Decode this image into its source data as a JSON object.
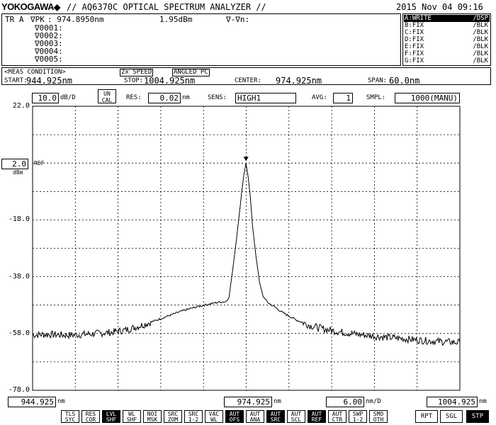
{
  "header": {
    "brand": "YOKOGAWA",
    "title": "// AQ6370C OPTICAL SPECTRUM ANALYZER //",
    "datetime": "2015 Nov 04 09:16"
  },
  "marker_panel": {
    "trace_label": "TR A",
    "peak_label": "∇PK",
    "peak_wavelength": ": 974.8950nm",
    "peak_level": "1.95dBm",
    "delta_label": "∇-∇n:",
    "markers": [
      "∇0001:",
      "∇0002:",
      "∇0003:",
      "∇0004:",
      "∇0005:"
    ]
  },
  "trace_list": [
    {
      "name": "A:WRITE",
      "mode": "/DSP",
      "active": true
    },
    {
      "name": "B:FIX",
      "mode": "/BLK",
      "active": false
    },
    {
      "name": "C:FIX",
      "mode": "/BLK",
      "active": false
    },
    {
      "name": "D:FIX",
      "mode": "/BLK",
      "active": false
    },
    {
      "name": "E:FIX",
      "mode": "/BLK",
      "active": false
    },
    {
      "name": "F:FIX",
      "mode": "/BLK",
      "active": false
    },
    {
      "name": "G:FIX",
      "mode": "/BLK",
      "active": false
    }
  ],
  "meas": {
    "title": "<MEAS CONDITION>",
    "speed": "2x SPEED",
    "connector": "ANGLED PC",
    "start_label": "START:",
    "start_value": "944.925nm",
    "stop_label": "STOP:",
    "stop_value": "1004.925nm",
    "center_label": "CENTER:",
    "center_value": "974.925nm",
    "span_label": "SPAN:",
    "span_value": "60.0nm"
  },
  "settings": {
    "scale_value": "10.0",
    "scale_unit": "dB/D",
    "uncal_line1": "UN",
    "uncal_line2": "CAL",
    "res_label": "RES:",
    "res_value": "0.02",
    "res_unit": "nm",
    "sens_label": "SENS:",
    "sens_value": "HIGH1",
    "avg_label": "AVG:",
    "avg_value": "1",
    "smpl_label": "SMPL:",
    "smpl_value": "1000(MANU)"
  },
  "ref": {
    "value": "2.0",
    "unit": "dBm",
    "label": "REF"
  },
  "footer": {
    "start": "944.925",
    "center": "974.925",
    "span_per_div": "6.00",
    "span_unit": "nm/D",
    "stop": "1004.925",
    "unit": "nm"
  },
  "soft_keys": [
    {
      "l1": "TLS",
      "l2": "SYC",
      "on": false
    },
    {
      "l1": "RES",
      "l2": "COR",
      "on": false
    },
    {
      "l1": "LVL",
      "l2": "SHF",
      "on": true
    },
    {
      "l1": "WL",
      "l2": "SHF",
      "on": false
    },
    {
      "l1": "NOI",
      "l2": "MSK",
      "on": false
    },
    {
      "l1": "SRC",
      "l2": "ZOM",
      "on": false
    },
    {
      "l1": "SRC",
      "l2": "1-2",
      "on": false
    },
    {
      "l1": "VAC",
      "l2": "WL",
      "on": false
    },
    {
      "l1": "AUT",
      "l2": "OFS",
      "on": true
    },
    {
      "l1": "AUT",
      "l2": "ANA",
      "on": false
    },
    {
      "l1": "AUT",
      "l2": "SRC",
      "on": true
    },
    {
      "l1": "AUT",
      "l2": "SCL",
      "on": false
    },
    {
      "l1": "AUT",
      "l2": "REF",
      "on": true
    },
    {
      "l1": "AUT",
      "l2": "CTR",
      "on": false
    },
    {
      "l1": "SWP",
      "l2": "1-2",
      "on": false
    },
    {
      "l1": "SMO",
      "l2": "OTH",
      "on": false
    }
  ],
  "sweep_keys": [
    {
      "label": "RPT",
      "on": false
    },
    {
      "label": "SGL",
      "on": false
    },
    {
      "label": "STP",
      "on": true
    }
  ],
  "chart_data": {
    "type": "line",
    "x_unit": "nm",
    "y_unit": "dBm",
    "xlim": [
      944.925,
      1004.925
    ],
    "ylim": [
      -78.0,
      22.0
    ],
    "y_tick_labels": [
      "22.0",
      "2.0",
      "-18.0",
      "-38.0",
      "-58.0",
      "-78.0"
    ],
    "y_ticks": [
      22.0,
      2.0,
      -18.0,
      -38.0,
      -58.0,
      -78.0
    ],
    "grid": true,
    "x_divisions": 10,
    "y_divisions": 10,
    "peak": {
      "x": 974.895,
      "y": 1.95
    },
    "series": [
      {
        "x": [
          944.925,
          947.0,
          950.0,
          953.0,
          956.0,
          958.0,
          960.0,
          962.0,
          964.0,
          966.0,
          968.0,
          970.0,
          971.0,
          972.0,
          972.5,
          973.0,
          973.5,
          974.0,
          974.3,
          974.6,
          974.895,
          975.2,
          975.5,
          975.8,
          976.3,
          976.8,
          977.3,
          978.0,
          979.0,
          980.0,
          982.0,
          984.0,
          986.0,
          988.0,
          990.0,
          992.0,
          994.0,
          996.0,
          998.0,
          1000.0,
          1002.0,
          1004.925
        ],
        "y": [
          -58.5,
          -58.3,
          -58.6,
          -58.2,
          -57.6,
          -56.8,
          -55.3,
          -53.6,
          -51.8,
          -50.0,
          -48.6,
          -47.5,
          -47.0,
          -46.8,
          -45.5,
          -36.0,
          -26.0,
          -15.0,
          -8.0,
          -2.0,
          1.95,
          -3.0,
          -10.0,
          -20.0,
          -31.0,
          -40.0,
          -45.0,
          -47.2,
          -48.8,
          -50.6,
          -53.3,
          -55.3,
          -56.5,
          -57.4,
          -58.1,
          -58.7,
          -59.2,
          -59.6,
          -60.1,
          -60.5,
          -60.8,
          -61.2
        ]
      }
    ]
  }
}
